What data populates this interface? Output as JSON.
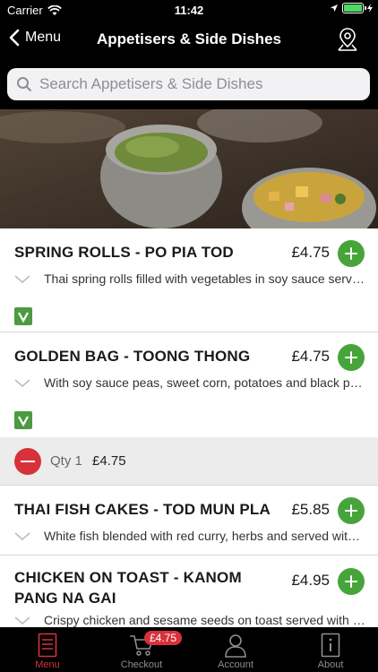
{
  "status": {
    "carrier": "Carrier",
    "time": "11:42"
  },
  "nav": {
    "back_label": "Menu",
    "title": "Appetisers & Side Dishes"
  },
  "search": {
    "placeholder": "Search Appetisers & Side Dishes"
  },
  "items": [
    {
      "name": "SPRING ROLLS - PO PIA TOD",
      "price": "£4.75",
      "desc": "Thai spring rolls filled with vegetables in soy sauce served with sweet chilli sauce",
      "veg": true
    },
    {
      "name": "GOLDEN BAG - TOONG THONG",
      "price": "£4.75",
      "desc": "With soy sauce peas, sweet corn, potatoes and black pepper",
      "veg": true
    },
    {
      "name": "THAI FISH CAKES - TOD MUN PLA",
      "price": "£5.85",
      "desc": "White fish blended with red curry, herbs and served with sweet chilli",
      "veg": false
    },
    {
      "name": "CHICKEN ON TOAST - KANOM PANG NA GAI",
      "price": "£4.95",
      "desc": "Crispy chicken and sesame seeds on toast served with sweet chilli sauce",
      "veg": false
    }
  ],
  "cart_line": {
    "qty": "Qty 1",
    "price": "£4.75"
  },
  "tabs": {
    "menu": "Menu",
    "checkout": "Checkout",
    "checkout_badge": "£4.75",
    "account": "Account",
    "about": "About"
  },
  "colors": {
    "accent": "#d7323a",
    "add": "#47a43a",
    "veg": "#4e9a43"
  }
}
